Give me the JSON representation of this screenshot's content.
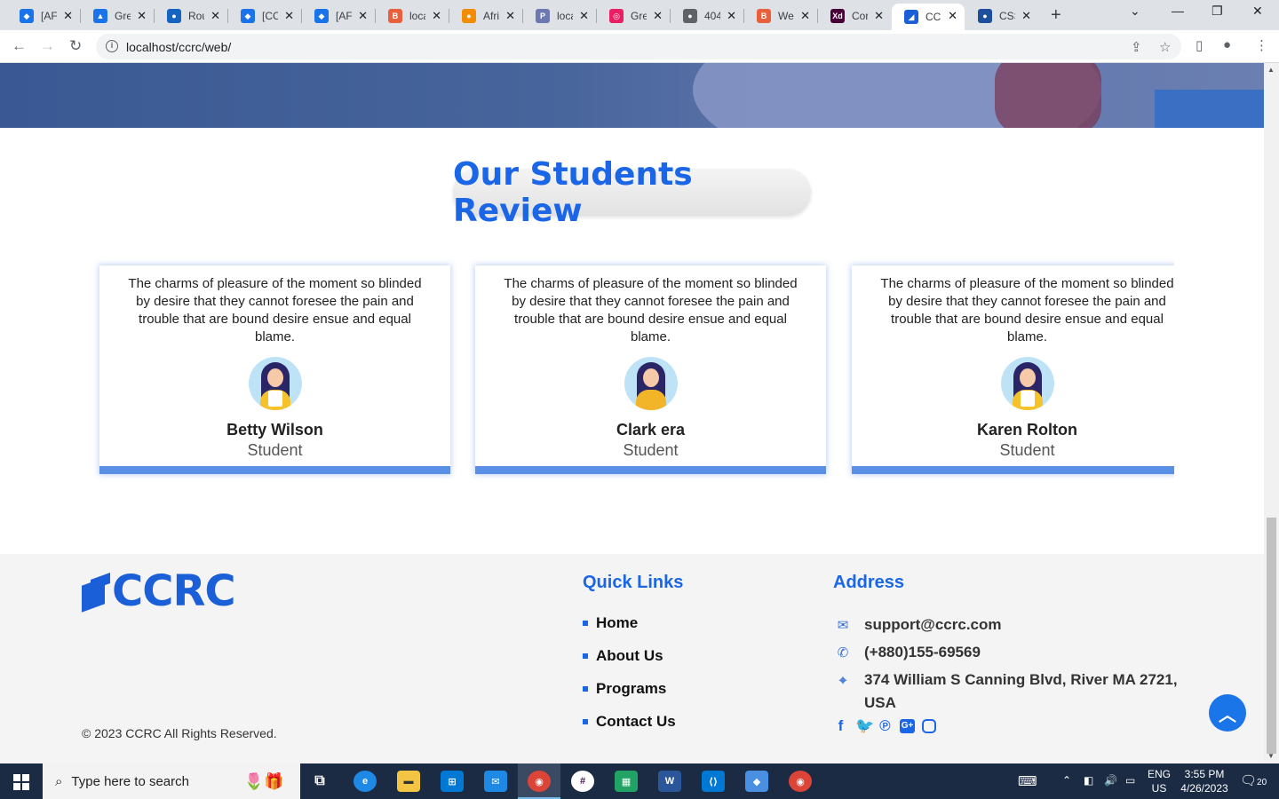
{
  "browser": {
    "tabs": [
      {
        "title": "[AF",
        "color": "#1a73e8",
        "glyph": "◆"
      },
      {
        "title": "Gre",
        "color": "#1a73e8",
        "glyph": "▲"
      },
      {
        "title": "Rou",
        "color": "#1565c0",
        "glyph": "●"
      },
      {
        "title": "[CC",
        "color": "#1a73e8",
        "glyph": "◆"
      },
      {
        "title": "[AF",
        "color": "#1a73e8",
        "glyph": "◆"
      },
      {
        "title": "loca",
        "color": "#e8613c",
        "glyph": "B"
      },
      {
        "title": "Afri",
        "color": "#f28c00",
        "glyph": "●"
      },
      {
        "title": "loca",
        "color": "#6c78af",
        "glyph": "P"
      },
      {
        "title": "Gre",
        "color": "#e91e63",
        "glyph": "◎"
      },
      {
        "title": "404",
        "color": "#5f6368",
        "glyph": "●"
      },
      {
        "title": "Wel",
        "color": "#e8613c",
        "glyph": "B"
      },
      {
        "title": "Cor",
        "color": "#470137",
        "glyph": "Xd"
      },
      {
        "title": "CCF",
        "color": "#1a5fd8",
        "glyph": "◢",
        "active": true
      },
      {
        "title": "CSS",
        "color": "#1e4f9c",
        "glyph": "●"
      }
    ],
    "url": "localhost/ccrc/web/"
  },
  "reviews": {
    "title": "Our Students Review",
    "cards": [
      {
        "quote": "The charms of pleasure of the moment so blinded by desire that they cannot foresee the pain and trouble that are bound desire ensue and equal blame.",
        "name": "Betty Wilson",
        "role": "Student"
      },
      {
        "quote": "The charms of pleasure of the moment so blinded by desire that they cannot foresee the pain and trouble that are bound desire ensue and equal blame.",
        "name": "Clark era",
        "role": "Student"
      },
      {
        "quote": "The charms of pleasure of the moment so blinded by desire that they cannot foresee the pain and trouble that are bound desire ensue and equal blame.",
        "name": "Karen Rolton",
        "role": "Student"
      }
    ]
  },
  "footer": {
    "logo": "CCRC",
    "copyright": "© 2023 CCRC All Rights Reserved.",
    "quick_links": {
      "title": "Quick Links",
      "items": [
        "Home",
        "About Us",
        "Programs",
        "Contact Us"
      ]
    },
    "address": {
      "title": "Address",
      "email": "support@ccrc.com",
      "phone": "(+880)155-69569",
      "location": "374 William S Canning Blvd, River MA 2721, USA"
    },
    "social": [
      "facebook-icon",
      "twitter-icon",
      "pinterest-icon",
      "google-plus-icon",
      "instagram-icon"
    ]
  },
  "taskbar": {
    "search_placeholder": "Type here to search",
    "lang": "ENG",
    "region": "US",
    "time": "3:55 PM",
    "date": "4/26/2023",
    "notifications": "20"
  }
}
